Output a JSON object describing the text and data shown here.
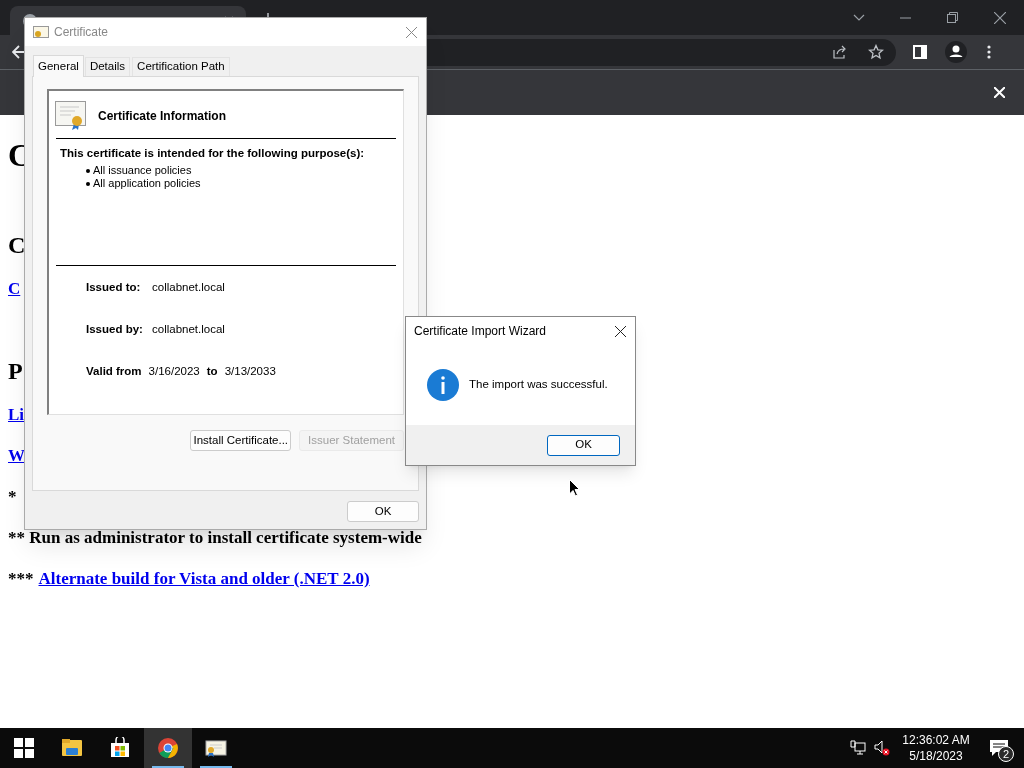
{
  "browser": {
    "page": [
      {
        "kind": "heading",
        "text": "C"
      },
      {
        "kind": "subheading",
        "text": "C"
      },
      {
        "kind": "link",
        "text": "C"
      },
      {
        "kind": "subheading",
        "text": "P"
      },
      {
        "kind": "link",
        "text": "Li"
      },
      {
        "kind": "link",
        "text": "W"
      },
      {
        "kind": "note",
        "text": "*"
      },
      {
        "kind": "note",
        "text": "** Run as administrator to install certificate system-wide"
      },
      {
        "kind": "note_link",
        "prefix": "***",
        "text": "Alternate build for Vista and older (.NET 2.0)"
      }
    ]
  },
  "certificate_dialog": {
    "title": "Certificate",
    "tabs": [
      {
        "label": "General",
        "selected": true
      },
      {
        "label": "Details",
        "selected": false
      },
      {
        "label": "Certification Path",
        "selected": false
      }
    ],
    "heading": "Certificate Information",
    "purpose_intro": "This certificate is intended for the following purpose(s):",
    "purposes": [
      "All issuance policies",
      "All application policies"
    ],
    "issued_to": {
      "label": "Issued to:",
      "value": "collabnet.local"
    },
    "issued_by": {
      "label": "Issued by:",
      "value": "collabnet.local"
    },
    "validity": {
      "label": "Valid from",
      "from": "3/16/2023",
      "separator": "to",
      "to": "3/13/2033"
    },
    "buttons": [
      {
        "label": "Install Certificate...",
        "disabled": false
      },
      {
        "label": "Issuer Statement",
        "disabled": true
      }
    ],
    "ok": "OK"
  },
  "import_wizard": {
    "title": "Certificate Import Wizard",
    "message": "The import was successful.",
    "ok": "OK"
  },
  "taskbar": {
    "apps": [
      {
        "kind": "folder",
        "active": false,
        "running": false
      },
      {
        "kind": "store",
        "active": false,
        "running": false
      },
      {
        "kind": "chrome",
        "active": true,
        "running": true
      },
      {
        "kind": "certificate",
        "active": false,
        "running": true
      }
    ],
    "time": "12:36:02 AM",
    "date": "5/18/2023",
    "notifications": "2"
  }
}
